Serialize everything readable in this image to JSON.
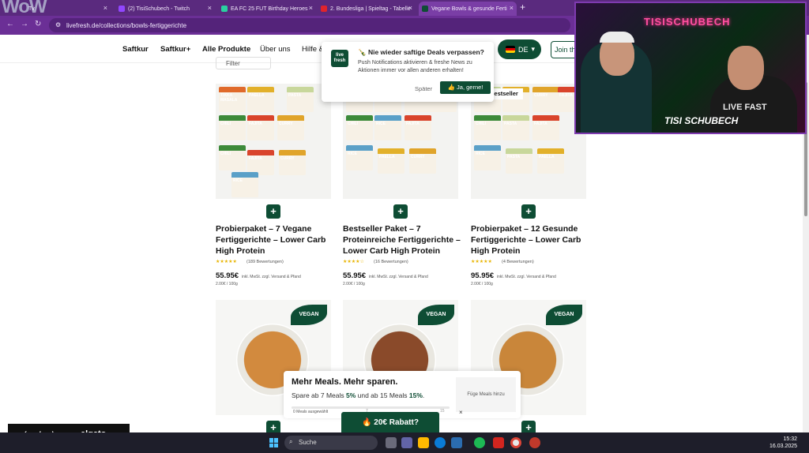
{
  "browser": {
    "tabs": [
      {
        "label": "(2) TisiSchubech - Twitch",
        "fav_color": "#9146ff"
      },
      {
        "label": "EA FC 25 FUT Birthday Heroes",
        "fav_color": "#2ad0a0"
      },
      {
        "label": "2. Bundesliga | Spieltag - Tabelle",
        "fav_color": "#e0242c"
      },
      {
        "label": "Vegane Bowls & gesunde Ferti",
        "fav_color": "#0e4d34"
      }
    ],
    "partial_tab_label": "Tv",
    "new_tab": "+",
    "close_glyph": "×",
    "url": "livefresh.de/collections/bowls-fertiggerichte",
    "nav": {
      "back": "←",
      "forward": "→",
      "reload": "↻"
    }
  },
  "site": {
    "nav": [
      "Saftkur",
      "Saftkur+",
      "Alle Produkte",
      "Über uns",
      "Hilfe &"
    ],
    "lang": "DE",
    "join": "Join th",
    "filter": "Filter"
  },
  "popup": {
    "logo": "live fresh",
    "title": "🍾 Nie wieder saftige Deals verpassen?",
    "body": "Push Notifications aktivieren & freshe News zu Aktionen immer vor allen anderen erhalten!",
    "later": "Später",
    "accept": "👍 Ja, gerne!"
  },
  "products": [
    {
      "title": "Probierpaket – 7 Vegane Fertiggerichte – Lower Carb High Protein",
      "stars": "★★★★★",
      "reviews": "(189 Bewertungen)",
      "price": "55.95€",
      "note": "inkl. MwSt. zzgl. Versand & Pfand",
      "unit": "2.00€ / 100g"
    },
    {
      "title": "Bestseller Paket – 7 Proteinreiche Fertiggerichte – Lower Carb High Protein",
      "stars": "★★★★☆",
      "reviews": "(16 Bewertungen)",
      "price": "55.95€",
      "note": "inkl. MwSt. zzgl. Versand & Pfand",
      "unit": "2.00€ / 100g"
    },
    {
      "title": "Probierpaket – 12 Gesunde Fertiggerichte – Lower Carb High Protein",
      "stars": "★★★★★",
      "reviews": "(4 Bewertungen)",
      "price": "95.95€",
      "note": "inkl. MwSt. zzgl. Versand & Pfand",
      "unit": "2.00€ / 100g"
    }
  ],
  "packs": [
    {
      "label": "TIKKA MASALA",
      "color": "#e06a2b"
    },
    {
      "label": "CHILI",
      "color": "#3c8a3a"
    },
    {
      "label": "FAJITA",
      "color": "#d9442c"
    },
    {
      "label": "CURRY",
      "color": "#e0a42b"
    },
    {
      "label": "RICE",
      "color": "#5aa0c8"
    },
    {
      "label": "PAELLA",
      "color": "#e2b02a"
    },
    {
      "label": "PASTA",
      "color": "#c8d79b"
    }
  ],
  "bestseller_badge": "Bestseller",
  "vegan_badge": "VEGAN",
  "add_glyph": "+",
  "promo": {
    "heading": "Mehr Meals. Mehr sparen.",
    "text_a": "Spare ab 7 Meals ",
    "pct_a": "5%",
    "text_b": " und ab 15 Meals ",
    "pct_b": "15%",
    "text_c": ".",
    "selected": "0 Meals ausgewählt",
    "mark1": "7",
    "mark2": "15",
    "add_meals": "Füge Meals hinzu",
    "close": "×"
  },
  "rabatt": "🔥 20€ Rabatt?",
  "stream": {
    "neon": "TISISCHUBECH",
    "overlay": "TISI SCHUBECH",
    "shirt": "LIVE FAST",
    "logo_left": "(unclear)",
    "logo_right": "elgato"
  },
  "taskbar": {
    "search": "Suche",
    "time": "15:32",
    "date": "16.03.2025"
  },
  "colors": {
    "brand_green": "#0e4d34",
    "browser_purple": "#6b2f96",
    "star": "#e8b400"
  }
}
